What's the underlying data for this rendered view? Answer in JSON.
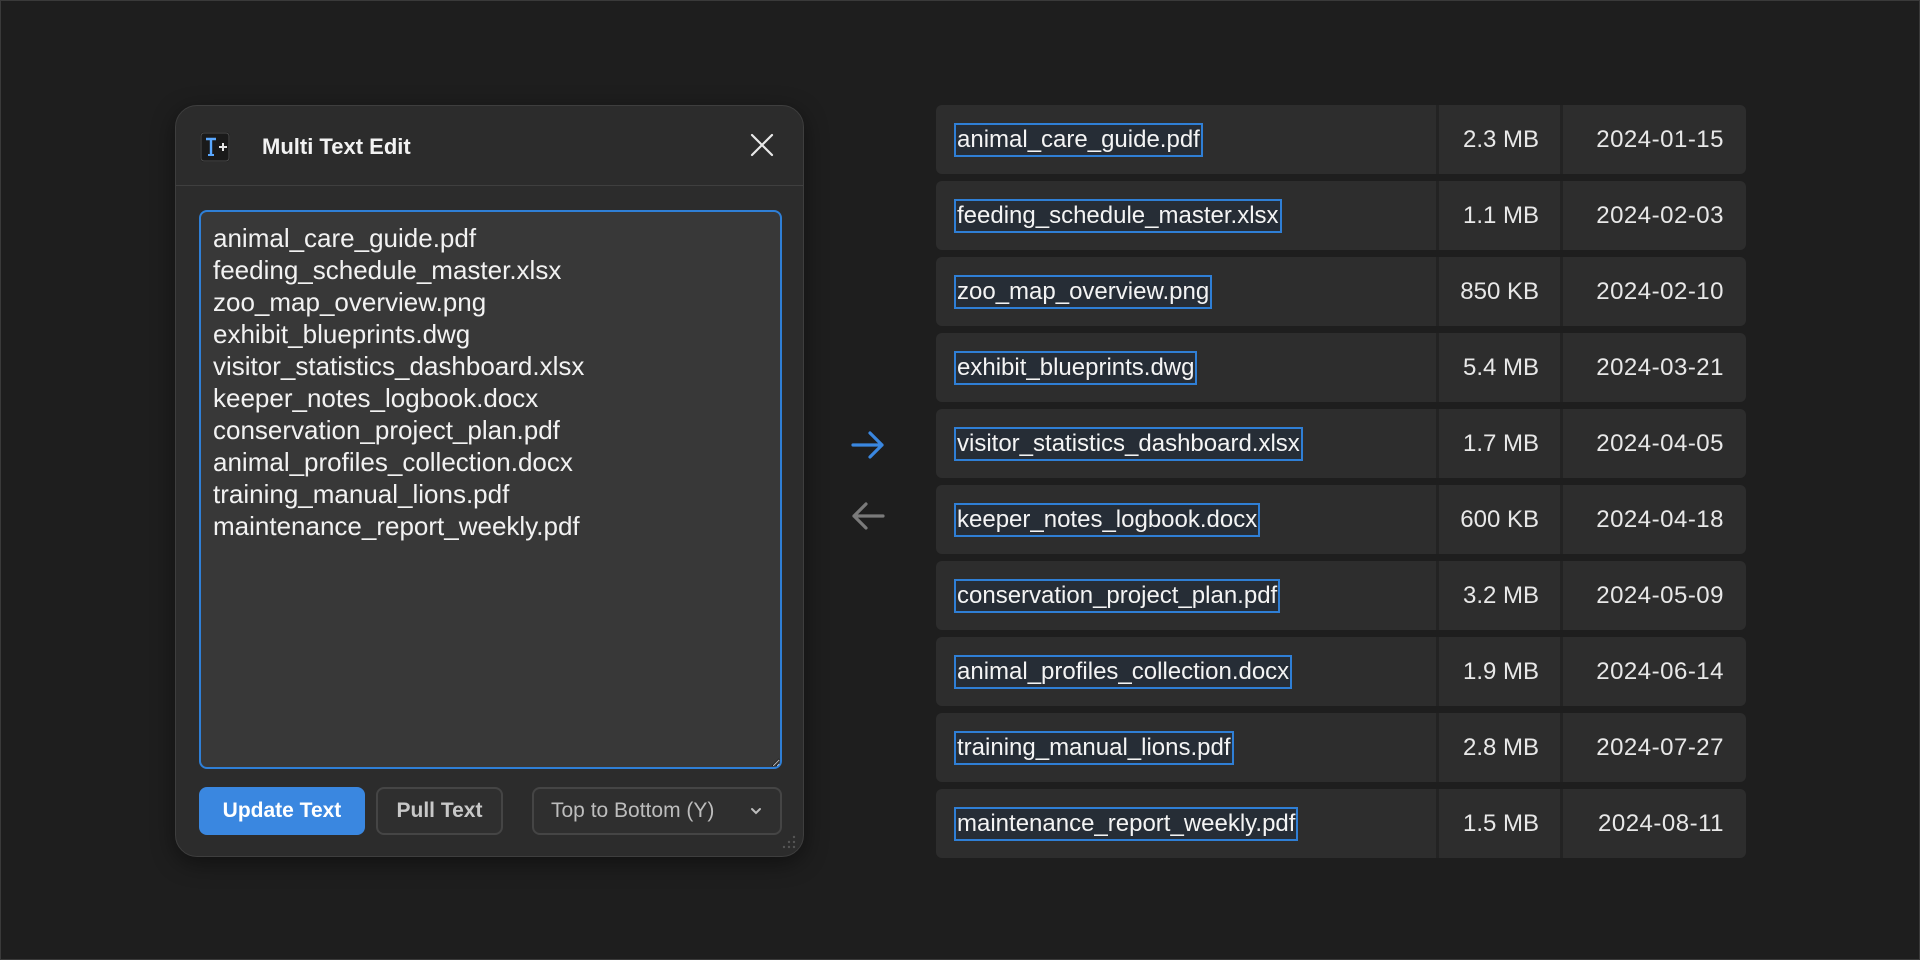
{
  "dialog": {
    "title": "Multi Text Edit",
    "icon": "text-plus-icon",
    "textarea_value": "animal_care_guide.pdf\nfeeding_schedule_master.xlsx\nzoo_map_overview.png\nexhibit_blueprints.dwg\nvisitor_statistics_dashboard.xlsx\nkeeper_notes_logbook.docx\nconservation_project_plan.pdf\nanimal_profiles_collection.docx\ntraining_manual_lions.pdf\nmaintenance_report_weekly.pdf",
    "update_button": "Update Text",
    "pull_button": "Pull Text",
    "order_select": "Top to Bottom (Y)"
  },
  "colors": {
    "accent": "#3a87e0",
    "selection_border": "#2f7fd6",
    "background": "#1e1e1e"
  },
  "files": [
    {
      "name": "animal_care_guide.pdf",
      "size": "2.3 MB",
      "date": "2024-01-15"
    },
    {
      "name": "feeding_schedule_master.xlsx",
      "size": "1.1 MB",
      "date": "2024-02-03"
    },
    {
      "name": "zoo_map_overview.png",
      "size": "850 KB",
      "date": "2024-02-10"
    },
    {
      "name": "exhibit_blueprints.dwg",
      "size": "5.4 MB",
      "date": "2024-03-21"
    },
    {
      "name": "visitor_statistics_dashboard.xlsx",
      "size": "1.7 MB",
      "date": "2024-04-05"
    },
    {
      "name": "keeper_notes_logbook.docx",
      "size": "600 KB",
      "date": "2024-04-18"
    },
    {
      "name": "conservation_project_plan.pdf",
      "size": "3.2 MB",
      "date": "2024-05-09"
    },
    {
      "name": "animal_profiles_collection.docx",
      "size": "1.9 MB",
      "date": "2024-06-14"
    },
    {
      "name": "training_manual_lions.pdf",
      "size": "2.8 MB",
      "date": "2024-07-27"
    },
    {
      "name": "maintenance_report_weekly.pdf",
      "size": "1.5 MB",
      "date": "2024-08-11"
    }
  ]
}
